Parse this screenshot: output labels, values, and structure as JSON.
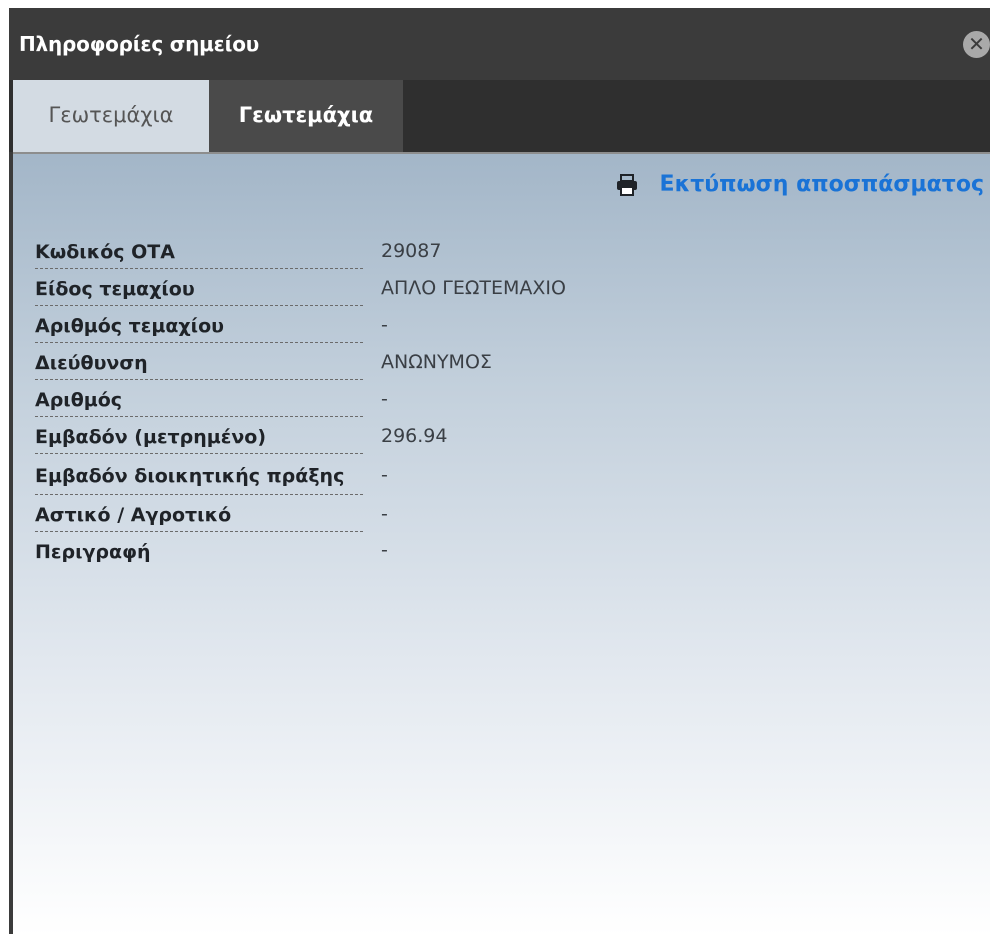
{
  "window": {
    "title": "Πληροφορίες σημείου",
    "close_icon": "close-circle-icon"
  },
  "tabs": [
    {
      "label": "Γεωτεμάχια",
      "active": true
    },
    {
      "label": "Γεωτεμάχια",
      "active": false
    }
  ],
  "toolbar": {
    "print_icon": "printer-icon",
    "print_label": "Εκτύπωση αποσπάσματος"
  },
  "properties": [
    {
      "label": "Κωδικός ΟΤΑ",
      "value": "29087"
    },
    {
      "label": "Είδος τεμαχίου",
      "value": "ΑΠΛΟ ΓΕΩΤΕΜΑΧΙΟ"
    },
    {
      "label": "Αριθμός τεμαχίου",
      "value": "-"
    },
    {
      "label": "Διεύθυνση",
      "value": "ΑΝΩΝΥΜΟΣ"
    },
    {
      "label": "Αριθμός",
      "value": "-"
    },
    {
      "label": "Εμβαδόν (μετρημένο)",
      "value": "296.94"
    },
    {
      "label": "Εμβαδόν διοικητικής πράξης",
      "value": "-"
    },
    {
      "label": "Αστικό / Αγροτικό",
      "value": "-"
    },
    {
      "label": "Περιγραφή",
      "value": "-"
    }
  ],
  "colors": {
    "titlebar": "#3b3b3b",
    "link": "#1a73d6",
    "active_tab": "#d3dbe3"
  }
}
